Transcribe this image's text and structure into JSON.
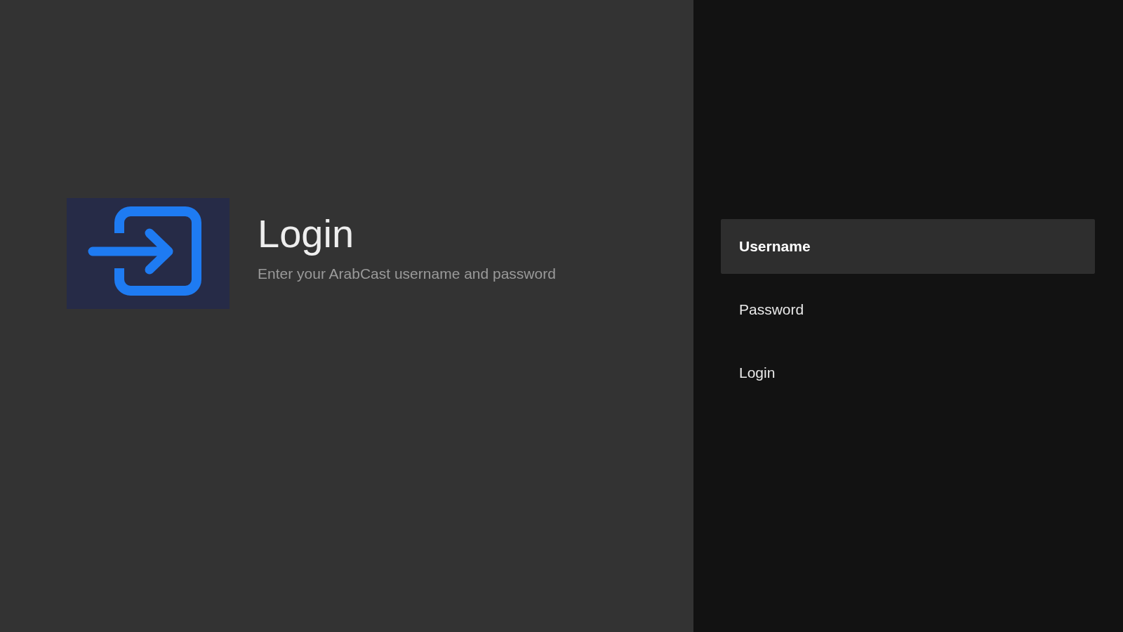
{
  "guidance": {
    "title": "Login",
    "description": "Enter your ArabCast username and password"
  },
  "actions": [
    {
      "label": "Username",
      "selected": true
    },
    {
      "label": "Password",
      "selected": false
    },
    {
      "label": "Login",
      "selected": false
    }
  ]
}
